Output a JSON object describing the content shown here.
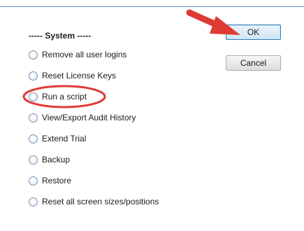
{
  "dialog": {
    "group_header": "----- System -----",
    "options": [
      {
        "label": "Remove all user logins",
        "selected": false
      },
      {
        "label": "Reset License Keys",
        "selected": false
      },
      {
        "label": "Run a script",
        "selected": false,
        "highlighted": true
      },
      {
        "label": "View/Export Audit History",
        "selected": false
      },
      {
        "label": "Extend Trial",
        "selected": false
      },
      {
        "label": "Backup",
        "selected": false
      },
      {
        "label": "Restore",
        "selected": false
      },
      {
        "label": "Reset all screen sizes/positions",
        "selected": false
      }
    ],
    "buttons": {
      "ok_label": "OK",
      "cancel_label": "Cancel"
    }
  },
  "colors": {
    "annotation": "#e03a35",
    "default_button_border": "#3c7fb1",
    "top_border": "#5b93c9"
  },
  "annotations": {
    "arrow_icon": "red-arrow-pointing-at-ok",
    "ellipse_icon": "red-ellipse-around-run-a-script"
  }
}
